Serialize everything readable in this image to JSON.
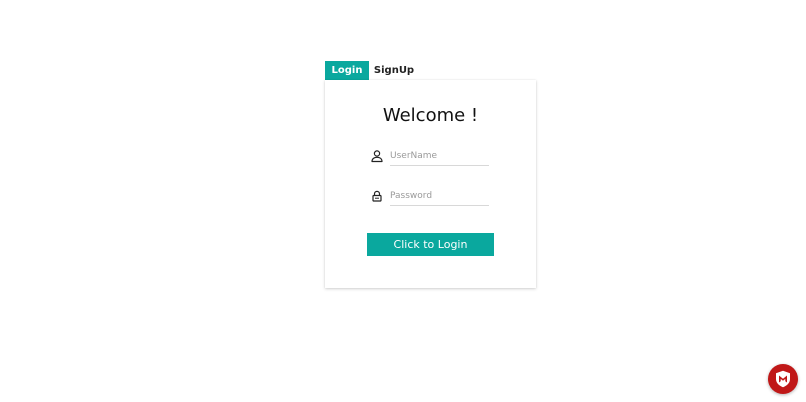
{
  "tabs": {
    "login": "Login",
    "signup": "SignUp"
  },
  "card": {
    "title": "Welcome !",
    "username_placeholder": "UserName",
    "password_placeholder": "Password",
    "login_button": "Click to Login"
  },
  "icons": {
    "username": "user-icon",
    "password": "lock-icon",
    "security_badge": "mcafee-shield-icon"
  },
  "colors": {
    "accent": "#0aa89e",
    "badge": "#c01818"
  }
}
